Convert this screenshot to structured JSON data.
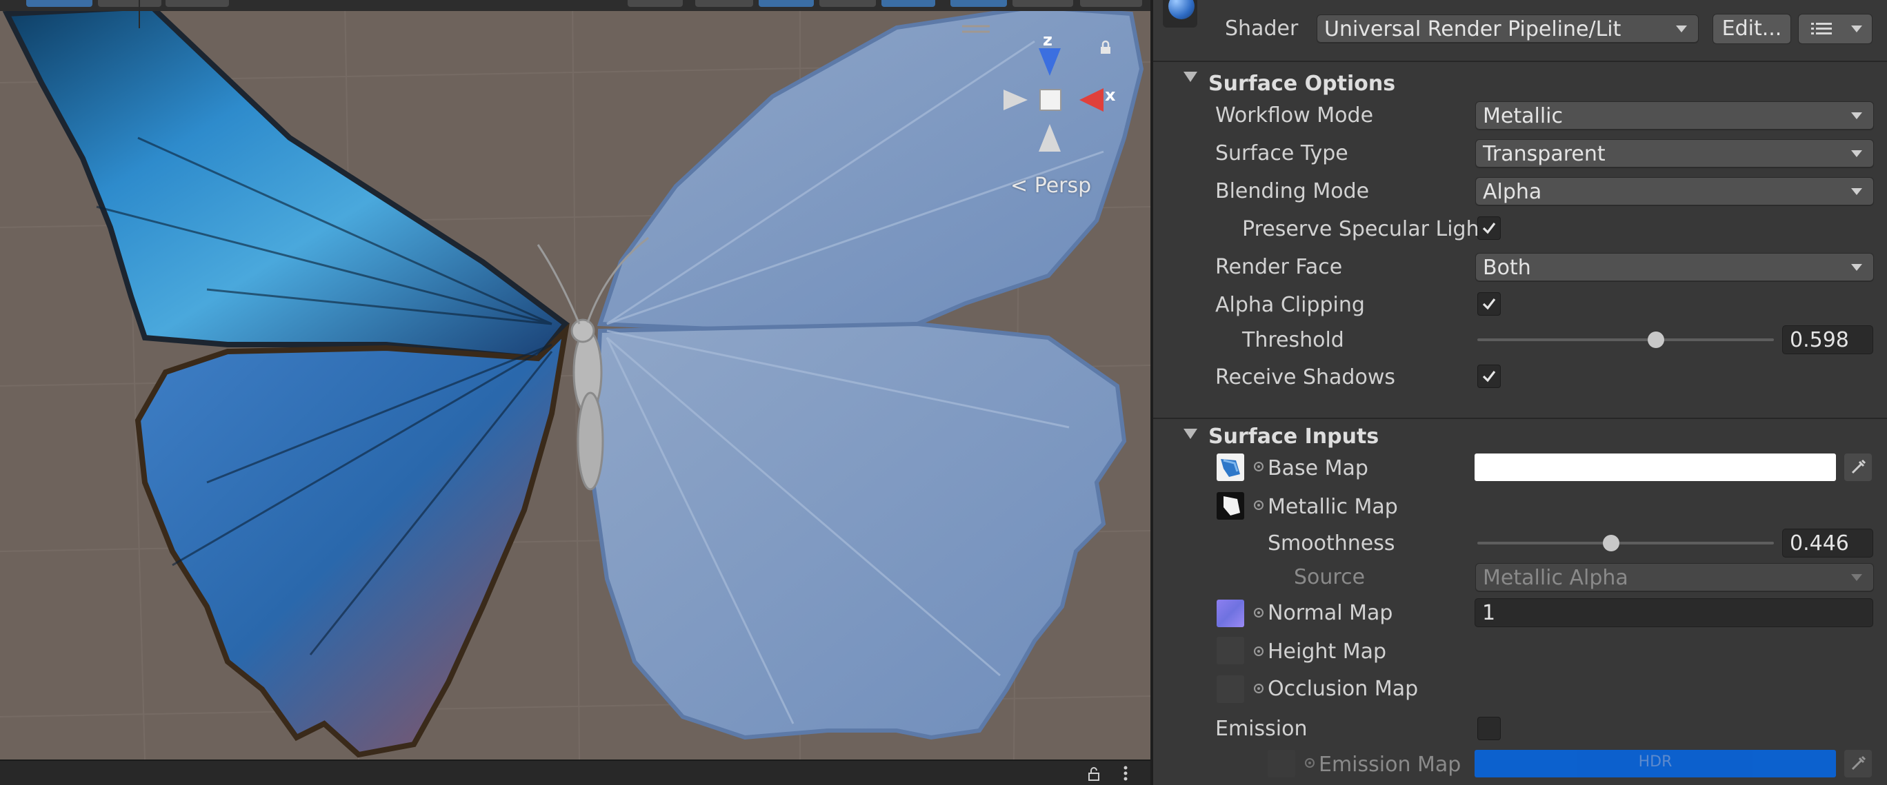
{
  "scene": {
    "persp_label": "Persp",
    "axis_z": "z",
    "axis_x": "x"
  },
  "inspector": {
    "shader": {
      "label": "Shader",
      "value": "Universal Render Pipeline/Lit",
      "edit_label": "Edit..."
    },
    "surface_options": {
      "title": "Surface Options",
      "workflow_mode": {
        "label": "Workflow Mode",
        "value": "Metallic"
      },
      "surface_type": {
        "label": "Surface Type",
        "value": "Transparent"
      },
      "blending_mode": {
        "label": "Blending Mode",
        "value": "Alpha"
      },
      "preserve_specular": {
        "label": "Preserve Specular Ligh",
        "checked": true
      },
      "render_face": {
        "label": "Render Face",
        "value": "Both"
      },
      "alpha_clipping": {
        "label": "Alpha Clipping",
        "checked": true
      },
      "threshold": {
        "label": "Threshold",
        "value": "0.598",
        "fraction": 0.598
      },
      "receive_shadows": {
        "label": "Receive Shadows",
        "checked": true
      }
    },
    "surface_inputs": {
      "title": "Surface Inputs",
      "base_map": {
        "label": "Base Map",
        "color": "#ffffff"
      },
      "metallic_map": {
        "label": "Metallic Map"
      },
      "smoothness": {
        "label": "Smoothness",
        "value": "0.446",
        "fraction": 0.446
      },
      "source": {
        "label": "Source",
        "value": "Metallic Alpha"
      },
      "normal_map": {
        "label": "Normal Map",
        "value": "1"
      },
      "height_map": {
        "label": "Height Map"
      },
      "occlusion_map": {
        "label": "Occlusion Map"
      },
      "emission": {
        "label": "Emission",
        "checked": false
      },
      "emission_map": {
        "label": "Emission Map",
        "hdr_label": "HDR",
        "color": "#0a63d6"
      }
    }
  }
}
